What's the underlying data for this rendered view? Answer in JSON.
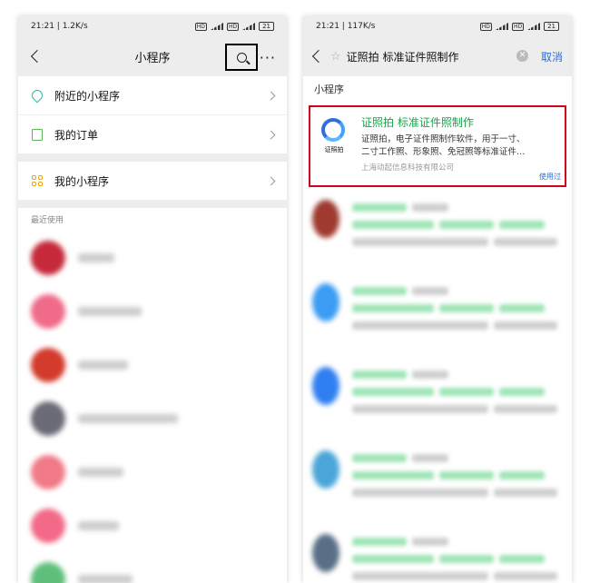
{
  "left": {
    "status_time": "21:21 | 1.2K/s",
    "battery": "21",
    "title": "小程序",
    "menu": [
      {
        "label": "附近的小程序",
        "icon": "location-icon"
      },
      {
        "label": "我的订单",
        "icon": "order-icon"
      },
      {
        "label": "我的小程序",
        "icon": "mini-program-grid-icon"
      }
    ],
    "recent_label": "最近使用",
    "recent_items": [
      {
        "avatar_color": "#c62a3a",
        "text_width": 40
      },
      {
        "avatar_color": "#f06a8a",
        "text_width": 70
      },
      {
        "avatar_color": "#d33b2b",
        "text_width": 55
      },
      {
        "avatar_color": "#6b6b78",
        "text_width": 110
      },
      {
        "avatar_color": "#f07a86",
        "text_width": 50
      },
      {
        "avatar_color": "#f26a88",
        "text_width": 45
      },
      {
        "avatar_color": "#5fbf7a",
        "text_width": 60
      }
    ]
  },
  "right": {
    "status_time": "21:21 | 117K/s",
    "battery": "21",
    "search_text": "证照拍 标准证件照制作",
    "cancel_label": "取消",
    "section_label": "小程序",
    "first_result": {
      "title": "证照拍 标准证件照制作",
      "desc_line1": "证照拍，电子证件照制作软件，用于一寸、",
      "desc_line2": "二寸工作照、形象照、免冠照等标准证件…",
      "company": "上海动起信息科技有限公司",
      "used": "使用过",
      "logo_label": "证照拍"
    },
    "blurred_results": [
      {
        "avatar_color": "#9e3a2f"
      },
      {
        "avatar_color": "#3a9cf2"
      },
      {
        "avatar_color": "#2f7ff0"
      },
      {
        "avatar_color": "#4aa6d8"
      },
      {
        "avatar_color": "#5a6f86"
      }
    ]
  },
  "colors": {
    "accent_green": "#19a34a",
    "highlight_red": "#d0021b",
    "link_blue": "#2a6fd6"
  }
}
